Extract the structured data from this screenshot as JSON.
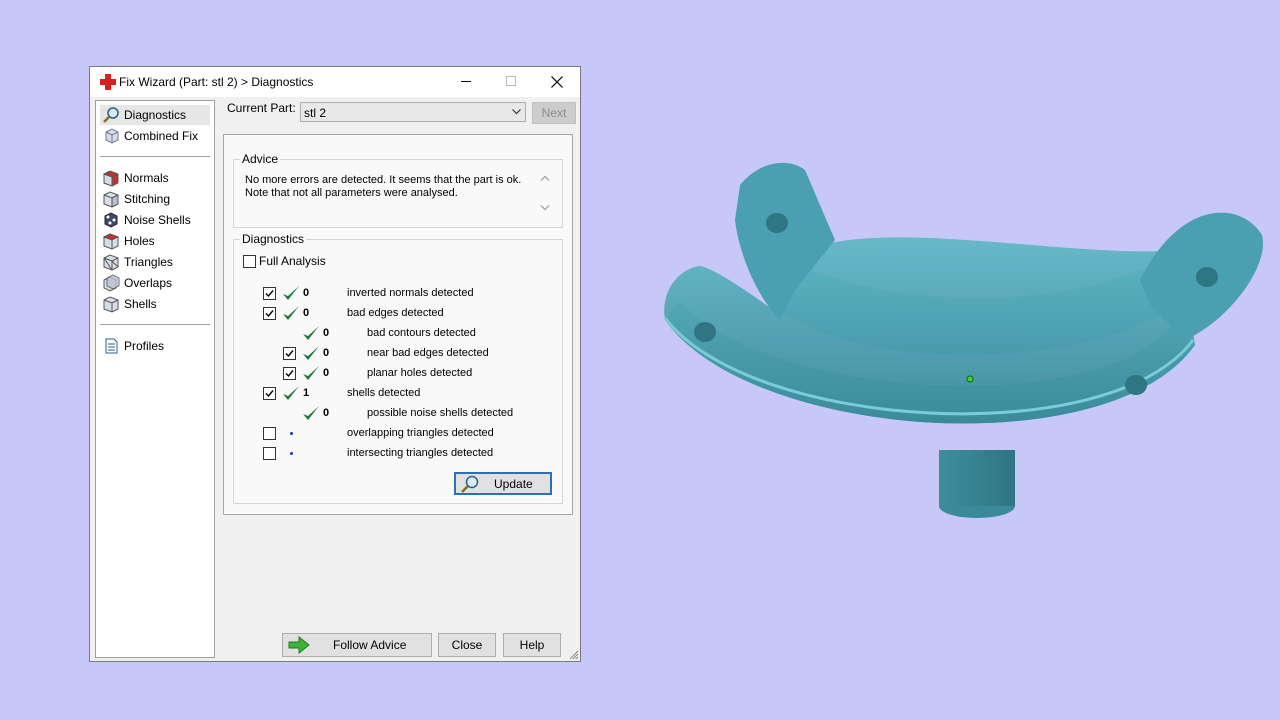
{
  "window": {
    "title": "Fix Wizard (Part: stl 2) > Diagnostics",
    "controls": {
      "minimize": "minimize",
      "maximize": "maximize",
      "close": "close"
    }
  },
  "nav": {
    "top": [
      {
        "label": "Diagnostics",
        "icon": "diagnostics-icon",
        "selected": true
      },
      {
        "label": "Combined Fix",
        "icon": "combined-fix-icon"
      }
    ],
    "tools": [
      {
        "label": "Normals",
        "icon": "normals-icon"
      },
      {
        "label": "Stitching",
        "icon": "stitching-icon"
      },
      {
        "label": "Noise Shells",
        "icon": "noise-shells-icon"
      },
      {
        "label": "Holes",
        "icon": "holes-icon"
      },
      {
        "label": "Triangles",
        "icon": "triangles-icon"
      },
      {
        "label": "Overlaps",
        "icon": "overlaps-icon"
      },
      {
        "label": "Shells",
        "icon": "shells-icon"
      }
    ],
    "bottom": [
      {
        "label": "Profiles",
        "icon": "profiles-icon"
      }
    ]
  },
  "current_part": {
    "label": "Current Part:",
    "value": "stl 2"
  },
  "next_button": "Next",
  "advice": {
    "title": "Advice",
    "text": "No more errors are detected. It seems that the part is ok.\nNote that not all parameters were analysed."
  },
  "diagnostics": {
    "title": "Diagnostics",
    "full_analysis": {
      "label": "Full Analysis",
      "checked": false
    },
    "rows": [
      {
        "checkbox": "checked",
        "status": "ok",
        "count": "0",
        "text": "inverted normals detected",
        "indent": 0
      },
      {
        "checkbox": "checked",
        "status": "ok",
        "count": "0",
        "text": "bad edges detected",
        "indent": 0
      },
      {
        "checkbox": "none",
        "status": "ok",
        "count": "0",
        "text": "bad contours detected",
        "indent": 1
      },
      {
        "checkbox": "checked",
        "status": "ok",
        "count": "0",
        "text": "near bad edges detected",
        "indent": 1
      },
      {
        "checkbox": "checked",
        "status": "ok",
        "count": "0",
        "text": "planar holes detected",
        "indent": 1
      },
      {
        "checkbox": "checked",
        "status": "ok",
        "count": "1",
        "text": "shells detected",
        "indent": 0
      },
      {
        "checkbox": "none",
        "status": "ok",
        "count": "0",
        "text": "possible noise shells detected",
        "indent": 1
      },
      {
        "checkbox": "unchecked",
        "status": "pending",
        "count": "",
        "text": "overlapping triangles detected",
        "indent": 0
      },
      {
        "checkbox": "unchecked",
        "status": "pending",
        "count": "",
        "text": "intersecting triangles detected",
        "indent": 0
      }
    ],
    "update_button": "Update"
  },
  "buttons": {
    "follow_advice": "Follow Advice",
    "close": "Close",
    "help": "Help"
  },
  "colors": {
    "background": "#c8c8f8",
    "model": "#4aa0b0",
    "check_green": "#1f7a3a",
    "accent_blue": "#2f6fb6"
  }
}
